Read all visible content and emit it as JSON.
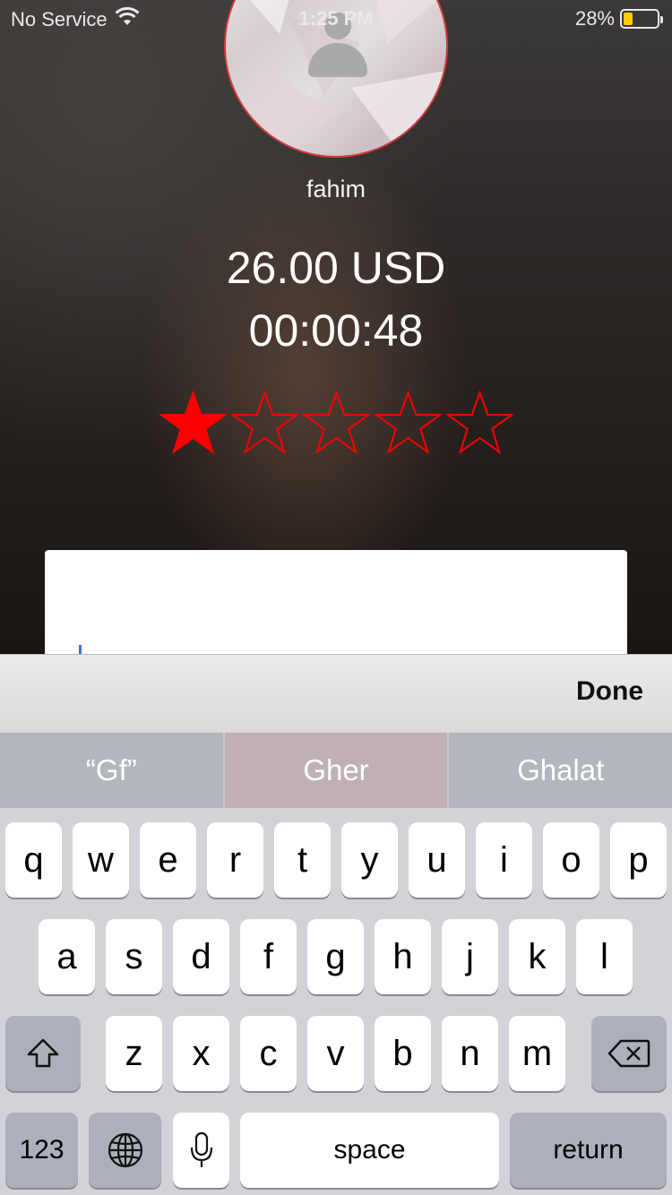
{
  "status_bar": {
    "carrier": "No Service",
    "time": "1:25 PM",
    "battery_percent": "28%",
    "battery_level": 0.28,
    "battery_color": "#ffcc00"
  },
  "profile": {
    "name": "fahim",
    "amount": "26.00 USD",
    "duration": "00:00:48"
  },
  "rating": {
    "value": 1,
    "max": 5,
    "color": "#ff0000"
  },
  "comment": {
    "value": ""
  },
  "accessory": {
    "done_label": "Done"
  },
  "suggestions": [
    "“Gf”",
    "Gher",
    "Ghalat"
  ],
  "keyboard": {
    "row1": [
      "q",
      "w",
      "e",
      "r",
      "t",
      "y",
      "u",
      "i",
      "o",
      "p"
    ],
    "row2": [
      "a",
      "s",
      "d",
      "f",
      "g",
      "h",
      "j",
      "k",
      "l"
    ],
    "row3": [
      "z",
      "x",
      "c",
      "v",
      "b",
      "n",
      "m"
    ],
    "numbers_label": "123",
    "space_label": "space",
    "return_label": "return"
  }
}
